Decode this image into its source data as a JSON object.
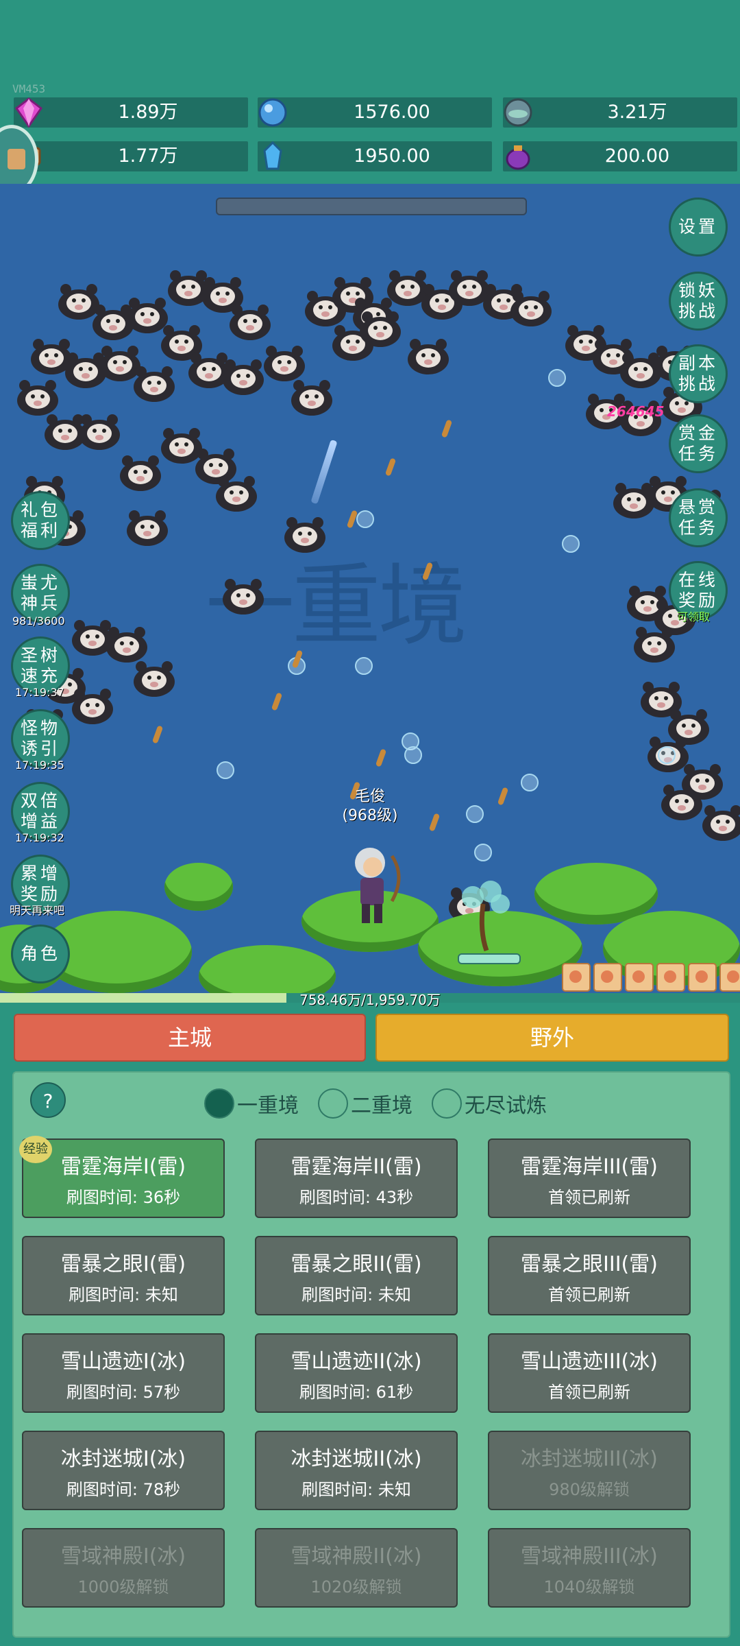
{
  "debug_label": "VM453",
  "currencies": [
    {
      "name": "diamond-icon",
      "value": "1.89万"
    },
    {
      "name": "blue-orb-icon",
      "value": "1576.00"
    },
    {
      "name": "gray-orb-icon",
      "value": "3.21万"
    },
    {
      "name": "scroll-icon",
      "value": "1.77万"
    },
    {
      "name": "crystal-icon",
      "value": "1950.00"
    },
    {
      "name": "purple-pouch-icon",
      "value": "200.00"
    }
  ],
  "game": {
    "realm_watermark": "一重境",
    "damage_number": "264645",
    "hero_name": "毛俊",
    "hero_level": "(968级)"
  },
  "right_buttons": [
    {
      "label": "设置"
    },
    {
      "label": "锁妖挑战"
    },
    {
      "label": "副本挑战"
    },
    {
      "label": "赏金任务"
    },
    {
      "label": "悬赏任务"
    },
    {
      "label": "在线奖励",
      "sub": "可领取"
    }
  ],
  "left_buttons": [
    {
      "label": "礼包福利",
      "sub": ""
    },
    {
      "label": "蚩尤神兵",
      "sub": "981/3600"
    },
    {
      "label": "圣树速充",
      "sub": "17:19:37"
    },
    {
      "label": "怪物诱引",
      "sub": "17:19:35"
    },
    {
      "label": "双倍增益",
      "sub": "17:19:32"
    },
    {
      "label": "累增奖励",
      "sub": "明天再来吧"
    },
    {
      "label": "角色",
      "sub": ""
    }
  ],
  "exp": {
    "text": "758.46万/1,959.70万",
    "fraction": 0.387
  },
  "tabs": {
    "main_city": "主城",
    "wild": "野外"
  },
  "panel": {
    "help": "?",
    "modes": [
      {
        "label": "一重境",
        "selected": true
      },
      {
        "label": "二重境",
        "selected": false
      },
      {
        "label": "无尽试炼",
        "selected": false
      }
    ],
    "exp_badge": "经验",
    "stages": [
      {
        "name": "雷霆海岸I(雷)",
        "status": "刷图时间: 36秒",
        "state": "active"
      },
      {
        "name": "雷霆海岸II(雷)",
        "status": "刷图时间: 43秒",
        "state": "normal"
      },
      {
        "name": "雷霆海岸III(雷)",
        "status": "首领已刷新",
        "state": "normal"
      },
      {
        "name": "雷暴之眼I(雷)",
        "status": "刷图时间: 未知",
        "state": "normal"
      },
      {
        "name": "雷暴之眼II(雷)",
        "status": "刷图时间: 未知",
        "state": "normal"
      },
      {
        "name": "雷暴之眼III(雷)",
        "status": "首领已刷新",
        "state": "normal"
      },
      {
        "name": "雪山遗迹I(冰)",
        "status": "刷图时间: 57秒",
        "state": "normal"
      },
      {
        "name": "雪山遗迹II(冰)",
        "status": "刷图时间: 61秒",
        "state": "normal"
      },
      {
        "name": "雪山遗迹III(冰)",
        "status": "首领已刷新",
        "state": "normal"
      },
      {
        "name": "冰封迷城I(冰)",
        "status": "刷图时间: 78秒",
        "state": "normal"
      },
      {
        "name": "冰封迷城II(冰)",
        "status": "刷图时间: 未知",
        "state": "normal"
      },
      {
        "name": "冰封迷城III(冰)",
        "status": "980级解锁",
        "state": "locked"
      },
      {
        "name": "雪域神殿I(冰)",
        "status": "1000级解锁",
        "state": "locked"
      },
      {
        "name": "雪域神殿II(冰)",
        "status": "1020级解锁",
        "state": "locked"
      },
      {
        "name": "雪域神殿III(冰)",
        "status": "1040级解锁",
        "state": "locked"
      }
    ]
  }
}
